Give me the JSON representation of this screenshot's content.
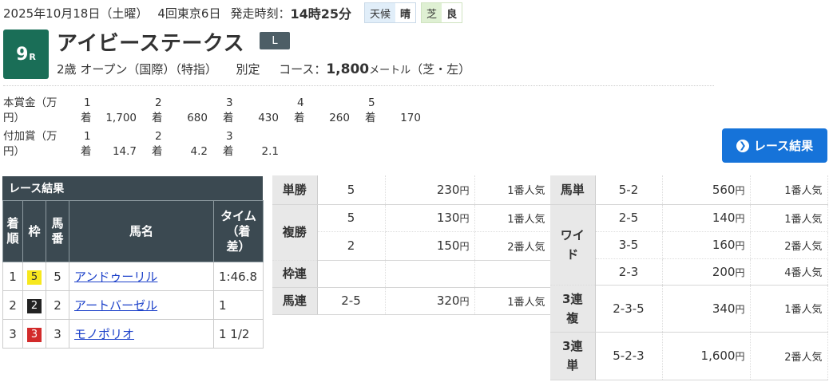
{
  "header": {
    "date": "2025年10月18日（土曜）",
    "meeting": "4回東京6日",
    "post_label": "発走時刻：",
    "post_time": "14時25分",
    "weather_label": "天候",
    "weather": "晴",
    "track_label": "芝",
    "track_cond": "良"
  },
  "race": {
    "number": "9",
    "number_suffix": "R",
    "name": "アイビーステークス",
    "grade": "L",
    "age": "2歳",
    "class": "オープン（国際）（特指）",
    "weight_rule": "別定",
    "course_label": "コース：",
    "distance": "1,800",
    "distance_unit": "メートル",
    "course_detail": "（芝・左）"
  },
  "prize": {
    "main_label": "本賞金（万円）",
    "main": [
      {
        "rank": "1",
        "suffix": "着",
        "amount": "1,700"
      },
      {
        "rank": "2",
        "suffix": "着",
        "amount": "680"
      },
      {
        "rank": "3",
        "suffix": "着",
        "amount": "430"
      },
      {
        "rank": "4",
        "suffix": "着",
        "amount": "260"
      },
      {
        "rank": "5",
        "suffix": "着",
        "amount": "170"
      }
    ],
    "extra_label": "付加賞（万円）",
    "extra": [
      {
        "rank": "1",
        "suffix": "着",
        "amount": "14.7"
      },
      {
        "rank": "2",
        "suffix": "着",
        "amount": "4.2"
      },
      {
        "rank": "3",
        "suffix": "着",
        "amount": "2.1"
      }
    ]
  },
  "result_button": "レース結果",
  "results": {
    "title": "レース結果",
    "headers": {
      "rank": "着順",
      "waku": "枠",
      "umaban": "馬番",
      "name": "馬名",
      "time": "タイム（着差）"
    },
    "rows": [
      {
        "rank": "1",
        "waku": "5",
        "umaban": "5",
        "name": "アンドゥーリル",
        "time": "1:46.8",
        "waku_bg": "#f7e81e",
        "waku_fg": "#333333"
      },
      {
        "rank": "2",
        "waku": "2",
        "umaban": "2",
        "name": "アートバーゼル",
        "time": "1",
        "waku_bg": "#222222",
        "waku_fg": "#ffffff"
      },
      {
        "rank": "3",
        "waku": "3",
        "umaban": "3",
        "name": "モノポリオ",
        "time": "1 1/2",
        "waku_bg": "#d22b2b",
        "waku_fg": "#ffffff"
      }
    ]
  },
  "payout": {
    "yen": "円",
    "tansho": {
      "type": "単勝",
      "combo": "5",
      "amount": "230",
      "pop": "1番人気"
    },
    "fukusho": {
      "type": "複勝",
      "rows": [
        {
          "combo": "5",
          "amount": "130",
          "pop": "1番人気"
        },
        {
          "combo": "2",
          "amount": "150",
          "pop": "2番人気"
        }
      ]
    },
    "wakuren": {
      "type": "枠連"
    },
    "umaren": {
      "type": "馬連",
      "combo": "2-5",
      "amount": "320",
      "pop": "1番人気"
    },
    "umatan": {
      "type": "馬単",
      "combo": "5-2",
      "amount": "560",
      "pop": "1番人気"
    },
    "wide": {
      "type": "ワイド",
      "rows": [
        {
          "combo": "2-5",
          "amount": "140",
          "pop": "1番人気"
        },
        {
          "combo": "3-5",
          "amount": "160",
          "pop": "2番人気"
        },
        {
          "combo": "2-3",
          "amount": "200",
          "pop": "4番人気"
        }
      ]
    },
    "sanrenpuku": {
      "type": "3連複",
      "combo": "2-3-5",
      "amount": "340",
      "pop": "1番人気"
    },
    "sanrentan": {
      "type": "3連単",
      "combo": "5-2-3",
      "amount": "1,600",
      "pop": "2番人気"
    }
  }
}
